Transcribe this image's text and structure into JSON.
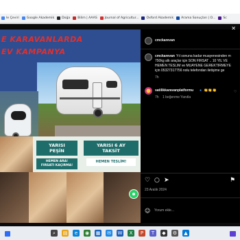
{
  "browser": {
    "bookmarks": [
      {
        "label": "le Çeviri",
        "color": "#4285f4"
      },
      {
        "label": "Google Akademik",
        "color": "#4285f4"
      },
      {
        "label": "Doğa",
        "color": "#222222"
      },
      {
        "label": "Bilim | AAAS",
        "color": "#c62828"
      },
      {
        "label": "Journal of Agricultur...",
        "color": "#d32f2f"
      },
      {
        "label": "Oxford Akademik",
        "color": "#1a237e"
      },
      {
        "label": "Arama Sonuçları | O...",
        "color": "#0d47a1"
      },
      {
        "label": "Sc",
        "color": "#4a148c"
      }
    ]
  },
  "post": {
    "close_icon": "✕",
    "author": "cmckarevan",
    "caption_author": "cmckarevan",
    "caption_lines": [
      "Yıl sonuna kadar muayenesinden m",
      "750kg altı araçlar için SON FIRSAT .. 10 YIL VE",
      "HEMEN TESLİM ve MUAYENE GEREKTİRMEYE",
      "için 05327317756 nolu telefondan iletişime ge"
    ],
    "caption_age": "7h",
    "comment": {
      "author": "satilikkaravanplatformu",
      "verified_icon": "verified-badge",
      "emoji": "👏👏👏",
      "age": "7h",
      "likes": "1 beğenme",
      "reply": "Yanıtla"
    },
    "date": "23 Aralık 2024",
    "comment_placeholder": "Yorum ekle..."
  },
  "media": {
    "headline_1": "E KARAVANLARDA",
    "headline_2": "EV KAMPANYA",
    "box_1_line_1": "YARISI",
    "box_1_line_2": "PEŞİN",
    "box_1_cta_1": "HEMEN ARA!",
    "box_1_cta_2": "FIRSATI KAÇIRMA!",
    "box_2_line_1": "YARISI 6 AY",
    "box_2_line_2": "TAKSİT",
    "box_2_cta": "HEMEN TESLİM!"
  },
  "taskbar": {
    "icons": [
      {
        "name": "search-icon",
        "glyph": "⌕",
        "color": "#444444"
      },
      {
        "name": "file-explorer-icon",
        "glyph": "▤",
        "color": "#e8a317"
      },
      {
        "name": "edge-icon",
        "glyph": "e",
        "color": "#0a84d8"
      },
      {
        "name": "chrome-icon",
        "glyph": "◉",
        "color": "#2e7d32"
      },
      {
        "name": "store-icon",
        "glyph": "▦",
        "color": "#1565c0"
      },
      {
        "name": "mail-icon",
        "glyph": "✉",
        "color": "#1e88e5"
      },
      {
        "name": "word-icon",
        "glyph": "W",
        "color": "#1e5bb8"
      },
      {
        "name": "excel-icon",
        "glyph": "X",
        "color": "#1e7b45"
      },
      {
        "name": "powerpoint-icon",
        "glyph": "P",
        "color": "#c4472b"
      },
      {
        "name": "teams-icon",
        "glyph": "T",
        "color": "#5b5fc7"
      },
      {
        "name": "vpn-icon",
        "glyph": "◆",
        "color": "#333333"
      },
      {
        "name": "settings-icon",
        "glyph": "⚙",
        "color": "#555555"
      },
      {
        "name": "photos-icon",
        "glyph": "▲",
        "color": "#0078d4"
      }
    ]
  },
  "colors": {
    "instagram_bg": "#000000",
    "banner_blue": "#2f4e92",
    "banner_red": "#e2302d",
    "teal": "#1f6d6a"
  }
}
